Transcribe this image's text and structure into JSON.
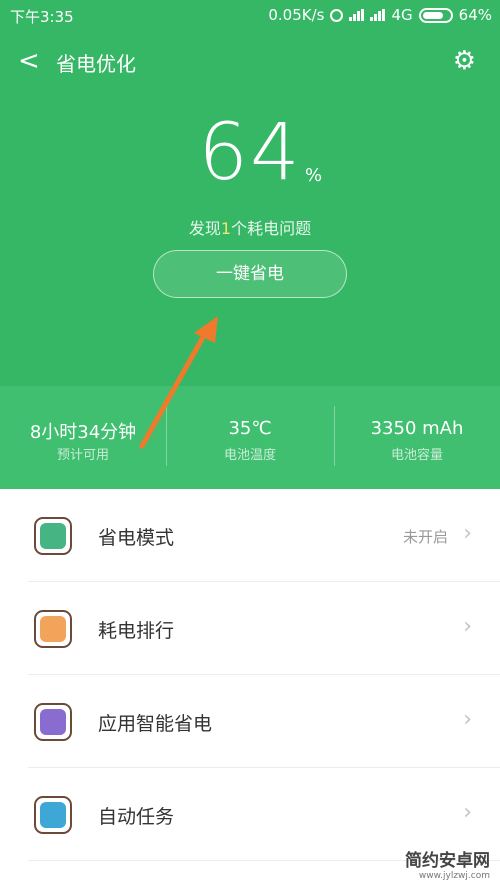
{
  "status": {
    "time": "下午3:35",
    "speed": "0.05K/s",
    "network": "4G",
    "battery": "64%"
  },
  "nav": {
    "back": "<",
    "title": "省电优化",
    "settings_icon": "gear-icon"
  },
  "hero": {
    "battery_value": "64",
    "battery_unit": "%",
    "issue_prefix": "发现",
    "issue_count": "1",
    "issue_suffix": "个耗电问题",
    "save_button": "一键省电"
  },
  "stats": [
    {
      "value": "8小时34分钟",
      "label": "预计可用"
    },
    {
      "value": "35℃",
      "label": "电池温度"
    },
    {
      "value": "3350 mAh",
      "label": "电池容量"
    }
  ],
  "menu": [
    {
      "name": "省电模式",
      "status": "未开启",
      "icon": "battery-mode-icon",
      "color": "#47b484"
    },
    {
      "name": "耗电排行",
      "status": "",
      "icon": "ranking-chart-icon",
      "color": "#f3a45a"
    },
    {
      "name": "应用智能省电",
      "status": "",
      "icon": "smart-bulb-icon",
      "color": "#8a6cd0"
    },
    {
      "name": "自动任务",
      "status": "",
      "icon": "scheduled-task-icon",
      "color": "#3fa7d6"
    }
  ],
  "watermark": {
    "title": "简约安卓网",
    "url": "www.jylzwj.com"
  },
  "colors": {
    "primary_green": "#35b765",
    "stats_green": "#3fbf6f",
    "arrow": "#f07a2c"
  }
}
